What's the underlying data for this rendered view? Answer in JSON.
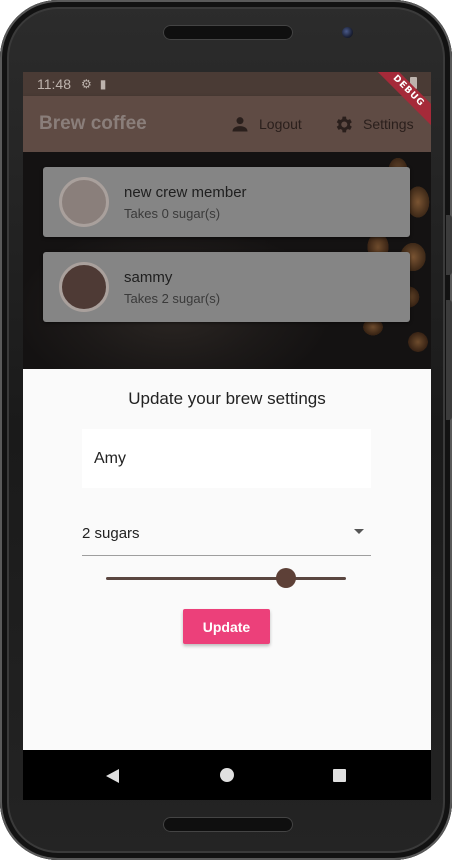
{
  "status_bar": {
    "time": "11:48",
    "debug_label": "DEBUG"
  },
  "app_bar": {
    "title": "Brew coffee",
    "logout_label": "Logout",
    "settings_label": "Settings"
  },
  "crew": [
    {
      "name": "new crew member",
      "sugars_text": "Takes 0 sugar(s)",
      "avatar_color": "#8a7f7b"
    },
    {
      "name": "sammy",
      "sugars_text": "Takes 2 sugar(s)",
      "avatar_color": "#4e3a35"
    }
  ],
  "settings_form": {
    "title": "Update your brew settings",
    "name_value": "Amy",
    "sugars_selected": "2 sugars",
    "strength_level": 0.75,
    "update_label": "Update"
  },
  "colors": {
    "app_bar": "#5f4b44",
    "accent_button": "#ec407a",
    "slider": "#5d4037"
  }
}
